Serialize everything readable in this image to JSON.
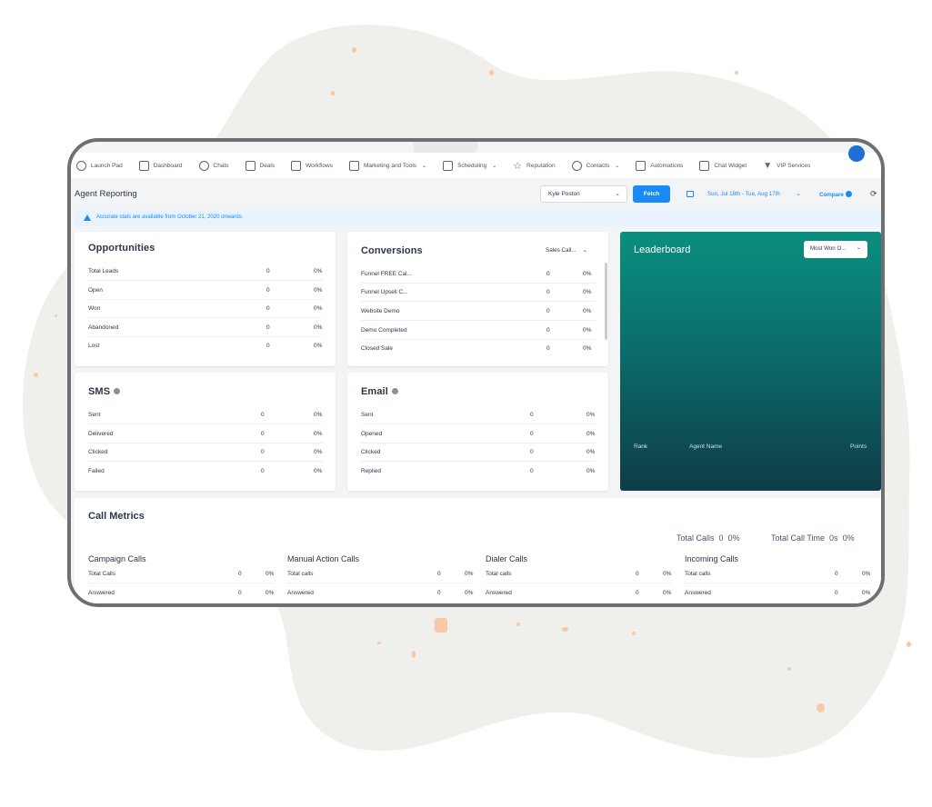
{
  "nav": {
    "items": [
      {
        "label": "Launch Pad",
        "icon": "rocket-icon"
      },
      {
        "label": "Dashboard",
        "icon": "dashboard-icon"
      },
      {
        "label": "Chats",
        "icon": "chat-icon"
      },
      {
        "label": "Deals",
        "icon": "deals-icon"
      },
      {
        "label": "Workflows",
        "icon": "workflow-icon"
      },
      {
        "label": "Marketing and Tools",
        "icon": "toolbox-icon"
      },
      {
        "label": "Scheduling",
        "icon": "calendar-icon"
      },
      {
        "label": "Reputation",
        "icon": "star-icon"
      },
      {
        "label": "Contacts",
        "icon": "user-icon"
      },
      {
        "label": "Automations",
        "icon": "branch-icon"
      },
      {
        "label": "Chat Widget",
        "icon": "widget-icon"
      },
      {
        "label": "VIP Services",
        "icon": "filter-icon"
      }
    ]
  },
  "header": {
    "title": "Agent Reporting",
    "user_select": "Kyle Poston",
    "fetch_label": "Fetch",
    "date_range": "Sun, Jul 18th - Tue, Aug 17th",
    "compare_label": "Compare"
  },
  "notice": {
    "text": "Accurate stats are available from October 21, 2020 onwards."
  },
  "opportunities": {
    "title": "Opportunities",
    "rows": [
      {
        "label": "Total Leads",
        "count": "0",
        "pct": "0%"
      },
      {
        "label": "Open",
        "count": "0",
        "pct": "0%"
      },
      {
        "label": "Won",
        "count": "0",
        "pct": "0%"
      },
      {
        "label": "Abandoned",
        "count": "0",
        "pct": "0%"
      },
      {
        "label": "Lost",
        "count": "0",
        "pct": "0%"
      }
    ]
  },
  "conversions": {
    "title": "Conversions",
    "dropdown": "Sales Call...",
    "rows": [
      {
        "label": "Funnel FREE Cal...",
        "count": "0",
        "pct": "0%"
      },
      {
        "label": "Funnel Upsell C...",
        "count": "0",
        "pct": "0%"
      },
      {
        "label": "Website Demo",
        "count": "0",
        "pct": "0%"
      },
      {
        "label": "Demo Completed",
        "count": "0",
        "pct": "0%"
      },
      {
        "label": "Closed Sale",
        "count": "0",
        "pct": "0%"
      }
    ]
  },
  "leaderboard": {
    "title": "Leaderboard",
    "dropdown": "Most Won O...",
    "columns": {
      "rank": "Rank",
      "agent": "Agent Name",
      "points": "Points"
    }
  },
  "sms": {
    "title": "SMS",
    "rows": [
      {
        "label": "Sent",
        "count": "0",
        "pct": "0%"
      },
      {
        "label": "Delivered",
        "count": "0",
        "pct": "0%"
      },
      {
        "label": "Clicked",
        "count": "0",
        "pct": "0%"
      },
      {
        "label": "Failed",
        "count": "0",
        "pct": "0%"
      }
    ]
  },
  "email": {
    "title": "Email",
    "rows": [
      {
        "label": "Sent",
        "count": "0",
        "pct": "0%"
      },
      {
        "label": "Opened",
        "count": "0",
        "pct": "0%"
      },
      {
        "label": "Clicked",
        "count": "0",
        "pct": "0%"
      },
      {
        "label": "Replied",
        "count": "0",
        "pct": "0%"
      }
    ]
  },
  "call_metrics": {
    "title": "Call Metrics",
    "total_calls_label": "Total Calls",
    "total_calls_value": "0",
    "total_calls_pct": "0%",
    "total_time_label": "Total Call Time",
    "total_time_value": "0s",
    "total_time_pct": "0%",
    "columns": [
      {
        "title": "Campaign Calls",
        "rows": [
          {
            "label": "Total Calls",
            "count": "0",
            "pct": "0%"
          },
          {
            "label": "Answered",
            "count": "0",
            "pct": "0%"
          }
        ]
      },
      {
        "title": "Manual Action Calls",
        "rows": [
          {
            "label": "Total calls",
            "count": "0",
            "pct": "0%"
          },
          {
            "label": "Answered",
            "count": "0",
            "pct": "0%"
          }
        ]
      },
      {
        "title": "Dialer Calls",
        "rows": [
          {
            "label": "Total calls",
            "count": "0",
            "pct": "0%"
          },
          {
            "label": "Answered",
            "count": "0",
            "pct": "0%"
          }
        ]
      },
      {
        "title": "Incoming Calls",
        "rows": [
          {
            "label": "Total calls",
            "count": "0",
            "pct": "0%"
          },
          {
            "label": "Answered",
            "count": "0",
            "pct": "0%"
          }
        ]
      }
    ]
  },
  "colors": {
    "accent": "#188bf6",
    "leaderboard_top": "#0b8f7f",
    "leaderboard_bottom": "#0e3c47",
    "frame": "#6d6f72",
    "blob": "#eff0ec"
  }
}
